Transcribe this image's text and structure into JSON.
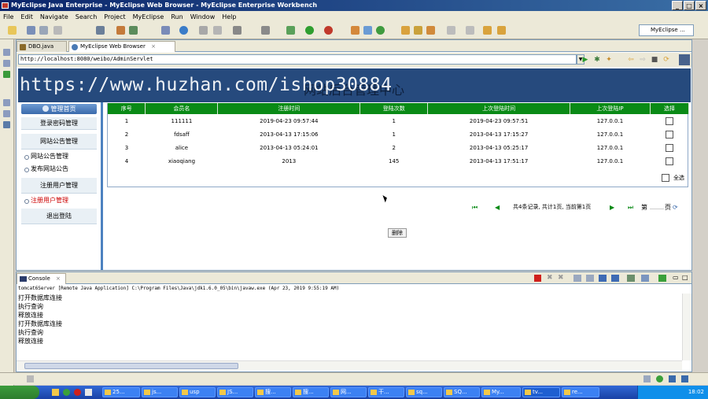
{
  "window": {
    "title": "MyEclipse Java Enterprise - MyEclipse Web Browser - MyEclipse Enterprise Workbench",
    "perspective_label": "MyEclipse ..."
  },
  "menu": [
    "File",
    "Edit",
    "Navigate",
    "Search",
    "Project",
    "MyEclipse",
    "Run",
    "Window",
    "Help"
  ],
  "editor_tabs": [
    {
      "label": "DBO.java",
      "active": false
    },
    {
      "label": "MyEclipse Web Browser",
      "active": true
    }
  ],
  "browser": {
    "url": "http://localhost:8080/weibo/AdminServlet",
    "watermark": "https://www.huzhan.com/ishop30884",
    "site_title": "网站后台管理中心"
  },
  "sidebar": {
    "header": "管理首页",
    "items": [
      "登录密码管理",
      "网站公告管理",
      "网站公告管理",
      "发布网站公告",
      "注册用户管理",
      "注册用户管理",
      "退出登陆"
    ]
  },
  "table": {
    "headers": [
      "序号",
      "会员名",
      "注册时间",
      "登陆次数",
      "上次登陆时间",
      "上次登陆IP",
      "选择"
    ],
    "rows": [
      [
        "1",
        "111111",
        "2019-04-23 09:57:44",
        "1",
        "2019-04-23 09:57:51",
        "127.0.0.1"
      ],
      [
        "2",
        "fdsaff",
        "2013-04-13 17:15:06",
        "1",
        "2013-04-13 17:15:27",
        "127.0.0.1"
      ],
      [
        "3",
        "alice",
        "2013-04-13 05:24:01",
        "2",
        "2013-04-13 05:25:17",
        "127.0.0.1"
      ],
      [
        "4",
        "xiaoqiang",
        "2013",
        "145",
        "2013-04-13 17:51:17",
        "127.0.0.1"
      ]
    ],
    "select_all": "全选"
  },
  "pager": {
    "summary": "共4条记录, 共计1页, 当前第1页",
    "goto_prefix": "第",
    "goto_suffix": "页"
  },
  "delete_label": "删除",
  "console": {
    "tab_label": "Console",
    "header": "tomcat6Server [Remote Java Application] C:\\Program Files\\Java\\jdk1.6.0_05\\bin\\javaw.exe (Apr 23, 2019 9:55:19 AM)",
    "lines": [
      "打开数据库连接",
      "执行查询",
      "释放连接",
      "打开数据库连接",
      "执行查询",
      "释放连接"
    ]
  },
  "taskbar": {
    "tasks": [
      "25...",
      "js...",
      "usp",
      "JS...",
      "搜...",
      "搜...",
      "网...",
      "干...",
      "sq...",
      "SQ...",
      "My...",
      "tv...",
      "re..."
    ],
    "clock": "18:02"
  },
  "colors": {
    "title_bar": "#0a246a",
    "table_header": "#0a8a16",
    "site_header": "#264a7d",
    "sidebar_border": "#4d82c0"
  }
}
